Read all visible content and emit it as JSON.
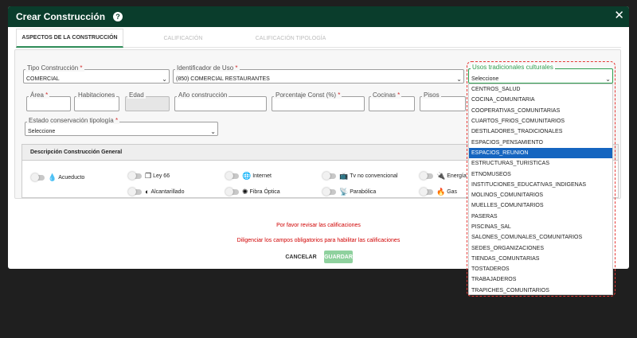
{
  "header": {
    "title": "Crear Construcción",
    "help_symbol": "?",
    "close_symbol": "✕"
  },
  "tabs": [
    {
      "label": "ASPECTOS DE LA CONSTRUCCIÓN",
      "active": true
    },
    {
      "label": "CALIFICACIÓN",
      "active": false
    },
    {
      "label": "CALIFICACIÓN TIPOLOGÍA",
      "active": false
    }
  ],
  "form": {
    "tipo_construccion": {
      "label": "Tipo Construcción",
      "required": "*",
      "value": "COMERCIAL"
    },
    "identificador_uso": {
      "label": "Identificador de Uso",
      "required": "*",
      "value": "(850) COMERCIAL RESTAURANTES"
    },
    "usos_tradicionales": {
      "label": "Usos tradicionales culturales",
      "value": "Seleccione"
    },
    "area": {
      "label": "Área",
      "required": "*",
      "value": ""
    },
    "habitaciones": {
      "label": "Habitaciones",
      "value": ""
    },
    "edad": {
      "label": "Edad",
      "value": ""
    },
    "anio_construccion": {
      "label": "Año construcción",
      "value": ""
    },
    "porcentaje_const": {
      "label": "Porcentaje Const (%)",
      "required": "*",
      "value": ""
    },
    "cocinas": {
      "label": "Cocinas",
      "required": "*",
      "value": ""
    },
    "pisos": {
      "label": "Pisos",
      "value": ""
    },
    "estado_conservacion": {
      "label": "Estado conservación tipología",
      "required": "*",
      "value": "Seleccione"
    }
  },
  "description": {
    "title": "Descripción Construcción General",
    "services": [
      {
        "label": "Acueducto",
        "icon": "water-drop-icon",
        "glyph": "💧"
      },
      {
        "label": "Ley 66",
        "icon": "copy-icon",
        "glyph": "❐"
      },
      {
        "label": "Internet",
        "icon": "globe-icon",
        "glyph": "🌐"
      },
      {
        "label": "Tv no convencional",
        "icon": "tv-icon",
        "glyph": "📺"
      },
      {
        "label": "Energía",
        "icon": "plug-icon",
        "glyph": "🔌"
      },
      {
        "label": "Alcantarillado",
        "icon": "half-circle-icon",
        "glyph": "◐"
      },
      {
        "label": "Fibra Óptica",
        "icon": "fiber-icon",
        "glyph": "✺"
      },
      {
        "label": "Parabólica",
        "icon": "antenna-icon",
        "glyph": "📡"
      },
      {
        "label": "Gas",
        "icon": "flame-icon",
        "glyph": "🔥"
      }
    ]
  },
  "messages": {
    "review": "Por favor revisar las calificaciones",
    "required_fields": "Diligenciar los campos obligatorios para habilitar las calificaciones"
  },
  "buttons": {
    "cancel": "CANCELAR",
    "save": "GUARDAR"
  },
  "dropdown": {
    "selected_index": 6,
    "options": [
      "CENTROS_SALUD",
      "COCINA_COMUNITARIA",
      "COOPERATIVAS_COMUNITARIAS",
      "CUARTOS_FRIOS_COMUNITARIOS",
      "DESTILADORES_TRADICIONALES",
      "ESPACIOS_PENSAMIENTO",
      "ESPACIOS_REUNION",
      "ESTRUCTURAS_TURISTICAS",
      "ETNOMUSEOS",
      "INSTITUCIONES_EDUCATIVAS_INDIGENAS",
      "MOLINOS_COMUNITARIOS",
      "MUELLES_COMUNITARIOS",
      "PASERAS",
      "PISCINAS_SAL",
      "SALONES_COMUNALES_COMUNITARIOS",
      "SEDES_ORGANIZACIONES",
      "TIENDAS_COMUNTARIAS",
      "TOSTADEROS",
      "TRABAJADEROS",
      "TRAPICHES_COMUNITARIOS"
    ]
  },
  "colors": {
    "header_bg": "#0a3d2c",
    "accent": "#2e8b57",
    "highlight": "#e53935",
    "selected": "#1565c0",
    "error_text": "#d00000"
  }
}
